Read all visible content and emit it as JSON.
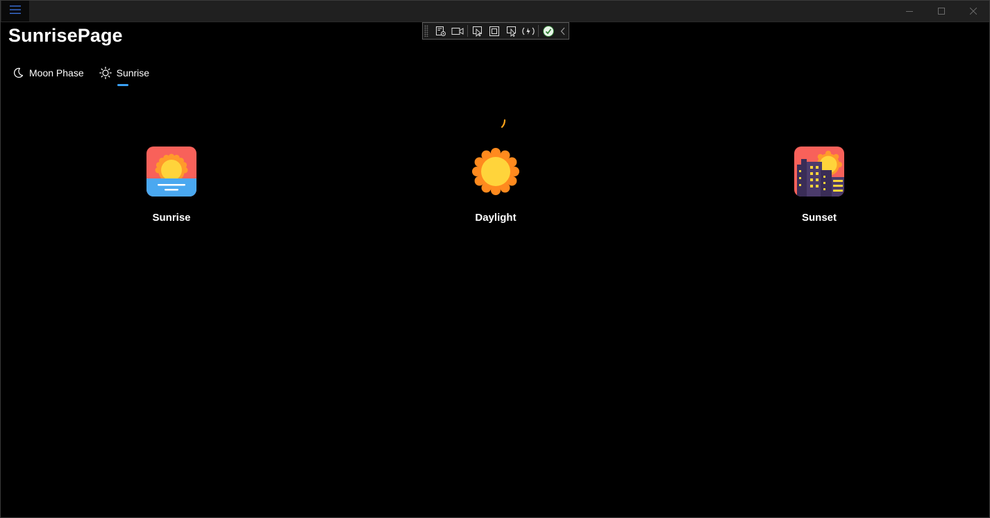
{
  "window": {
    "title": "SunrisePage"
  },
  "tabs": [
    {
      "label": "Moon Phase",
      "icon": "moon-icon",
      "selected": false
    },
    {
      "label": "Sunrise",
      "icon": "sun-icon",
      "selected": true
    }
  ],
  "tiles": [
    {
      "label": "Sunrise",
      "icon": "sunrise-icon"
    },
    {
      "label": "Daylight",
      "icon": "daylight-sun-icon"
    },
    {
      "label": "Sunset",
      "icon": "sunset-city-icon"
    }
  ],
  "colors": {
    "accent": "#3aa0f3",
    "background": "#000000",
    "sun_yellow": "#FFD43B",
    "sun_orange": "#FF8A1E",
    "sky_red": "#F8615A",
    "water_blue": "#4AA8F0",
    "building_purple": "#4B3B6B"
  }
}
